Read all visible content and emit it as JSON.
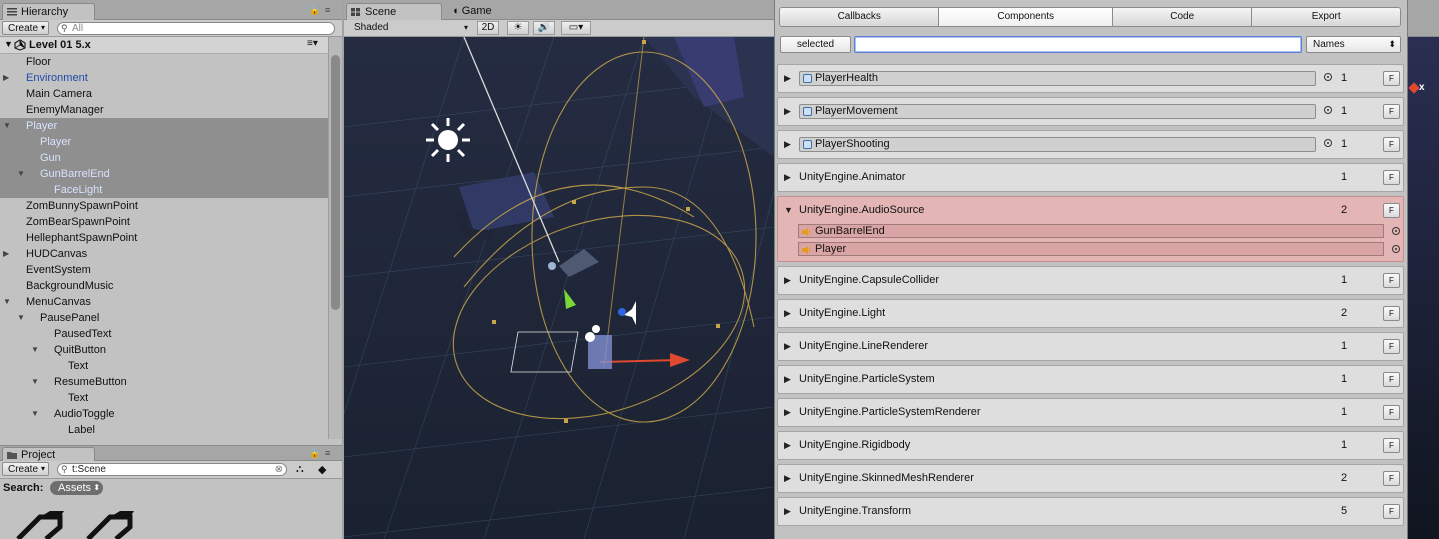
{
  "hierarchy": {
    "tab_label": "Hierarchy",
    "create_label": "Create",
    "search_placeholder": "All",
    "scene_name": "Level 01 5.x",
    "items": [
      {
        "label": "Floor",
        "depth": 0,
        "arrow": "",
        "style": "normal"
      },
      {
        "label": "Environment",
        "depth": 0,
        "arrow": "▶",
        "style": "blue"
      },
      {
        "label": "Main Camera",
        "depth": 0,
        "arrow": "",
        "style": "normal"
      },
      {
        "label": "EnemyManager",
        "depth": 0,
        "arrow": "",
        "style": "normal"
      },
      {
        "label": "Player",
        "depth": 0,
        "arrow": "▼",
        "style": "selected"
      },
      {
        "label": "Player",
        "depth": 1,
        "arrow": "",
        "style": "selected"
      },
      {
        "label": "Gun",
        "depth": 1,
        "arrow": "",
        "style": "selected"
      },
      {
        "label": "GunBarrelEnd",
        "depth": 1,
        "arrow": "▼",
        "style": "selected"
      },
      {
        "label": "FaceLight",
        "depth": 2,
        "arrow": "",
        "style": "selected"
      },
      {
        "label": "ZomBunnySpawnPoint",
        "depth": 0,
        "arrow": "",
        "style": "normal"
      },
      {
        "label": "ZomBearSpawnPoint",
        "depth": 0,
        "arrow": "",
        "style": "normal"
      },
      {
        "label": "HellephantSpawnPoint",
        "depth": 0,
        "arrow": "",
        "style": "normal"
      },
      {
        "label": "HUDCanvas",
        "depth": 0,
        "arrow": "▶",
        "style": "normal"
      },
      {
        "label": "EventSystem",
        "depth": 0,
        "arrow": "",
        "style": "normal"
      },
      {
        "label": "BackgroundMusic",
        "depth": 0,
        "arrow": "",
        "style": "normal"
      },
      {
        "label": "MenuCanvas",
        "depth": 0,
        "arrow": "▼",
        "style": "normal"
      },
      {
        "label": "PausePanel",
        "depth": 1,
        "arrow": "▼",
        "style": "normal"
      },
      {
        "label": "PausedText",
        "depth": 2,
        "arrow": "",
        "style": "normal"
      },
      {
        "label": "QuitButton",
        "depth": 2,
        "arrow": "▼",
        "style": "normal"
      },
      {
        "label": "Text",
        "depth": 3,
        "arrow": "",
        "style": "normal"
      },
      {
        "label": "ResumeButton",
        "depth": 2,
        "arrow": "▼",
        "style": "normal"
      },
      {
        "label": "Text",
        "depth": 3,
        "arrow": "",
        "style": "normal"
      },
      {
        "label": "AudioToggle",
        "depth": 2,
        "arrow": "▼",
        "style": "normal"
      },
      {
        "label": "Label",
        "depth": 3,
        "arrow": "",
        "style": "normal"
      }
    ]
  },
  "project": {
    "tab_label": "Project",
    "create_label": "Create",
    "search_value": "t:Scene",
    "search_label": "Search:",
    "assets_label": "Assets"
  },
  "scene": {
    "tab_scene": "Scene",
    "tab_game": "Game",
    "shading_mode": "Shaded",
    "mode_2d": "2D"
  },
  "components_window": {
    "tabs": [
      "Callbacks",
      "Components",
      "Code",
      "Export"
    ],
    "active_tab": "Components",
    "selected_button": "selected",
    "filter_value": "",
    "mode_select": "Names",
    "f_label": "F",
    "rows": [
      {
        "name": "PlayerHealth",
        "count": "1",
        "script": true
      },
      {
        "name": "PlayerMovement",
        "count": "1",
        "script": true
      },
      {
        "name": "PlayerShooting",
        "count": "1",
        "script": true
      },
      {
        "name": "UnityEngine.Animator",
        "count": "1",
        "script": false
      },
      {
        "name": "UnityEngine.AudioSource",
        "count": "2",
        "script": false,
        "expanded": true,
        "children": [
          "GunBarrelEnd",
          "Player"
        ]
      },
      {
        "name": "UnityEngine.CapsuleCollider",
        "count": "1",
        "script": false
      },
      {
        "name": "UnityEngine.Light",
        "count": "2",
        "script": false
      },
      {
        "name": "UnityEngine.LineRenderer",
        "count": "1",
        "script": false
      },
      {
        "name": "UnityEngine.ParticleSystem",
        "count": "1",
        "script": false
      },
      {
        "name": "UnityEngine.ParticleSystemRenderer",
        "count": "1",
        "script": false
      },
      {
        "name": "UnityEngine.Rigidbody",
        "count": "1",
        "script": false
      },
      {
        "name": "UnityEngine.SkinnedMeshRenderer",
        "count": "2",
        "script": false
      },
      {
        "name": "UnityEngine.Transform",
        "count": "5",
        "script": false
      }
    ]
  },
  "game_edge": {
    "close_glyph": "x"
  },
  "colors": {
    "selection_bg": "#8f8f8f",
    "expanded_row": "#e3b5b5",
    "scene_bg": "#1e2537",
    "gizmo": "#c9a54a"
  }
}
